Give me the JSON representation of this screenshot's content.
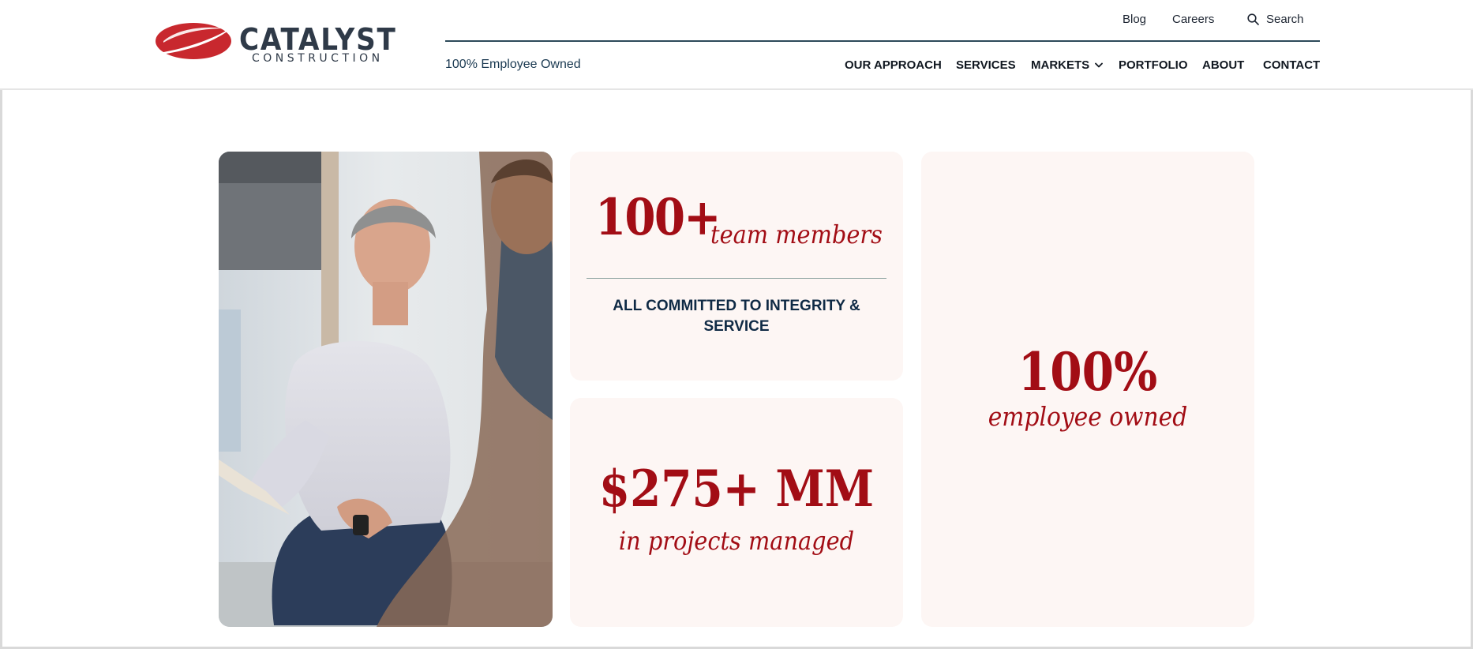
{
  "brand": {
    "name": "CATALYST",
    "subtitle": "CONSTRUCTION",
    "accent_color": "#c8282e",
    "ink_color": "#2f3a48"
  },
  "utility_nav": {
    "blog": "Blog",
    "careers": "Careers",
    "search": "Search"
  },
  "tagline": "100% Employee Owned",
  "main_nav": {
    "items": [
      {
        "label": "OUR APPROACH"
      },
      {
        "label": "SERVICES"
      },
      {
        "label": "MARKETS",
        "has_dropdown": true
      },
      {
        "label": "PORTFOLIO"
      },
      {
        "label": "ABOUT"
      },
      {
        "label": "CONTACT"
      }
    ]
  },
  "stats": {
    "team": {
      "value": "100+",
      "label": "team members",
      "caption_line1": "ALL COMMITTED TO INTEGRITY &",
      "caption_line2": "SERVICE"
    },
    "projects": {
      "value": "$275+ MM",
      "label": "in projects managed"
    },
    "ownership": {
      "value": "100%",
      "label": "employee owned"
    }
  },
  "colors": {
    "stat_red": "#a20d15",
    "card_bg": "#fdf6f4",
    "caption_navy": "#0f2a45",
    "nav_rule": "#2d4a5a"
  }
}
